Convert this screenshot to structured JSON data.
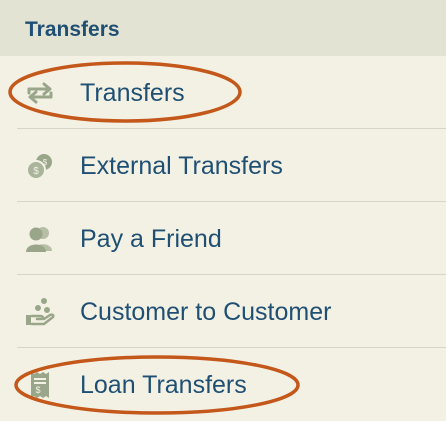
{
  "header": {
    "title": "Transfers"
  },
  "menu": {
    "items": [
      {
        "label": "Transfers",
        "icon": "transfer-arrows-icon",
        "highlighted": true
      },
      {
        "label": "External Transfers",
        "icon": "coins-icon",
        "highlighted": false
      },
      {
        "label": "Pay a Friend",
        "icon": "people-icon",
        "highlighted": false
      },
      {
        "label": "Customer to Customer",
        "icon": "hand-coins-icon",
        "highlighted": false
      },
      {
        "label": "Loan Transfers",
        "icon": "receipt-icon",
        "highlighted": true
      }
    ]
  },
  "colors": {
    "background": "#f3f1e4",
    "header_background": "#e3e3d4",
    "text": "#1f4f73",
    "icon": "#9aa68a",
    "annotation": "#c4571a",
    "divider": "#d7d6c6"
  }
}
